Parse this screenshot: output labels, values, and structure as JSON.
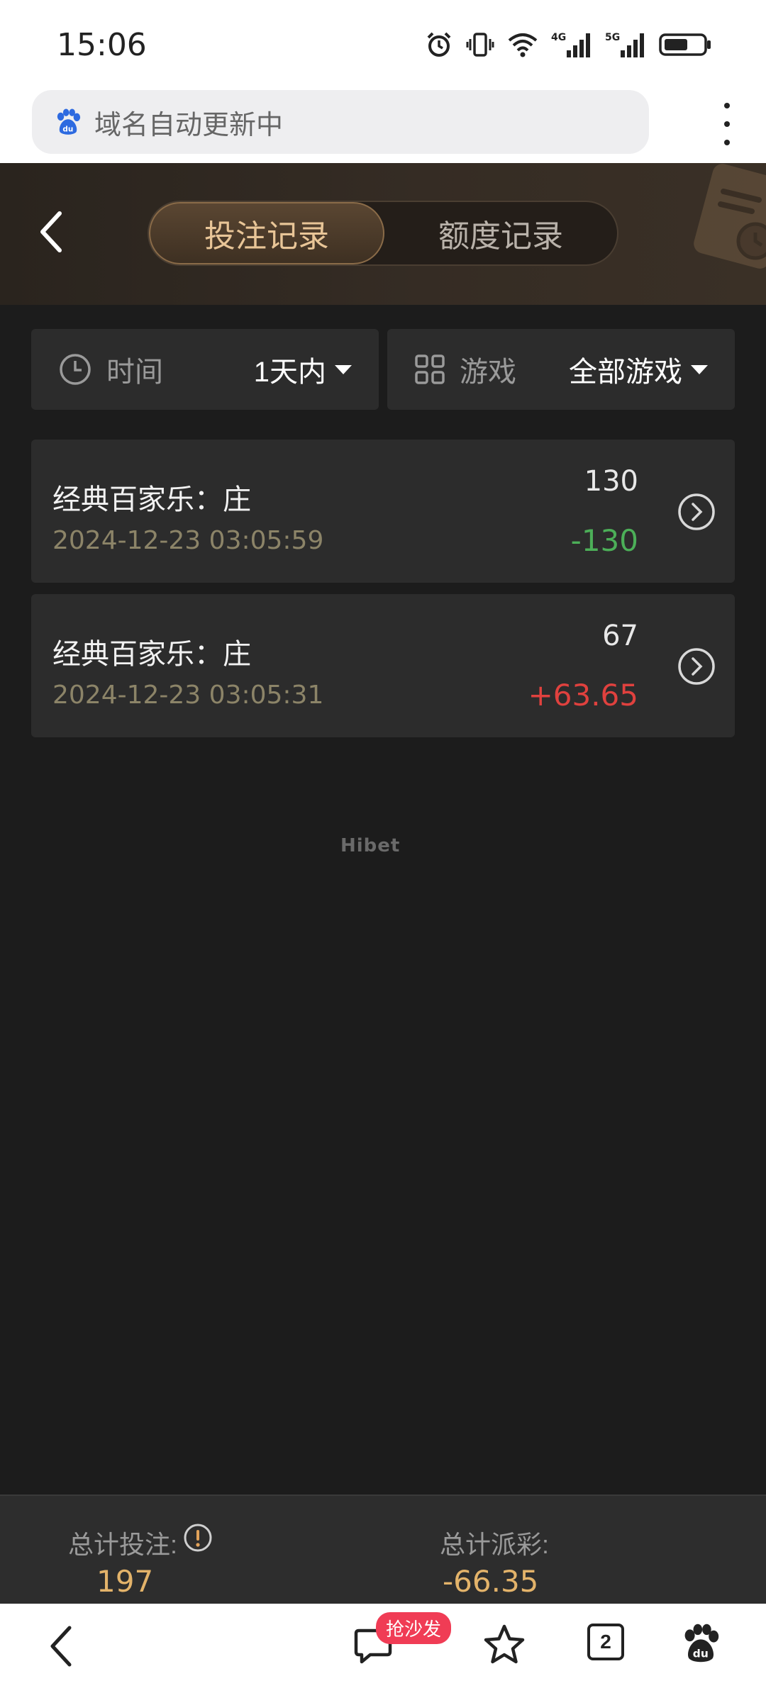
{
  "status_bar": {
    "time": "15:06",
    "network_1": "4G",
    "network_2": "5G"
  },
  "browser": {
    "url_text": "域名自动更新中"
  },
  "header": {
    "tabs": [
      {
        "label": "投注记录",
        "active": true
      },
      {
        "label": "额度记录",
        "active": false
      }
    ]
  },
  "filters": {
    "time": {
      "label": "时间",
      "value": "1天内"
    },
    "game": {
      "label": "游戏",
      "value": "全部游戏"
    }
  },
  "records": [
    {
      "title": "经典百家乐：庄",
      "time": "2024-12-23 03:05:59",
      "amount": "130",
      "payout": "-130"
    },
    {
      "title": "经典百家乐：庄",
      "time": "2024-12-23 03:05:31",
      "amount": "67",
      "payout": "+63.65"
    }
  ],
  "watermark": "Hibet",
  "summary": {
    "total_bet_label": "总计投注:",
    "total_bet_value": "197",
    "total_payout_label": "总计派彩:",
    "total_payout_value": "-66.35"
  },
  "bottom_nav": {
    "sofa_badge": "抢沙发",
    "tab_count": "2"
  },
  "colors": {
    "accent_gold": "#e3b36a",
    "loss_green": "#4caf58",
    "win_red": "#e0413e"
  }
}
